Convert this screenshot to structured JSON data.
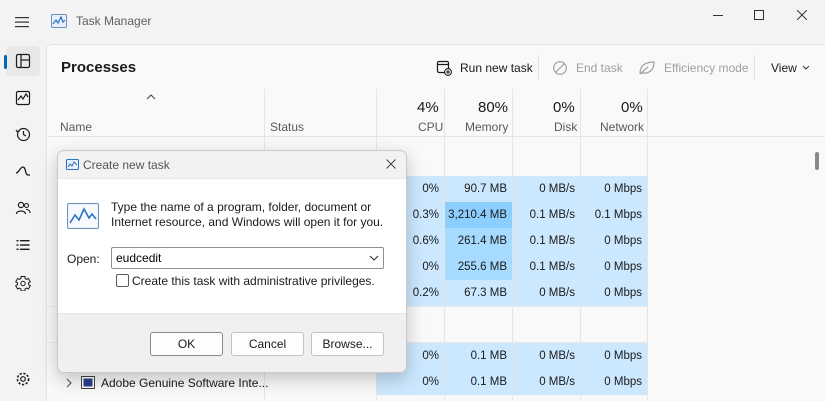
{
  "window": {
    "title": "Task Manager"
  },
  "nav": {
    "items": [
      "processes",
      "performance",
      "app-history",
      "startup-apps",
      "users",
      "details",
      "services"
    ],
    "settings": "settings"
  },
  "toolbar": {
    "title": "Processes",
    "run_new_task": "Run new task",
    "end_task": "End task",
    "efficiency_mode": "Efficiency mode",
    "view": "View"
  },
  "table": {
    "headers": {
      "name": "Name",
      "status": "Status",
      "cpu": {
        "pct": "4%",
        "label": "CPU"
      },
      "memory": {
        "pct": "80%",
        "label": "Memory"
      },
      "disk": {
        "pct": "0%",
        "label": "Disk"
      },
      "network": {
        "pct": "0%",
        "label": "Network"
      }
    },
    "rows": [
      {
        "cpu": "0%",
        "memory": "90.7 MB",
        "disk": "0 MB/s",
        "network": "0 Mbps"
      },
      {
        "cpu": "0.3%",
        "memory": "3,210.4 MB",
        "disk": "0.1 MB/s",
        "network": "0.1 Mbps"
      },
      {
        "cpu": "0.6%",
        "memory": "261.4 MB",
        "disk": "0.1 MB/s",
        "network": "0 Mbps"
      },
      {
        "cpu": "0%",
        "memory": "255.6 MB",
        "disk": "0.1 MB/s",
        "network": "0 Mbps"
      },
      {
        "cpu": "0.2%",
        "memory": "67.3 MB",
        "disk": "0 MB/s",
        "network": "0 Mbps"
      },
      {
        "cpu": "0%",
        "memory": "0.1 MB",
        "disk": "0 MB/s",
        "network": "0 Mbps"
      },
      {
        "name": "Adobe Genuine Software Inte...",
        "cpu": "0%",
        "memory": "0.1 MB",
        "disk": "0 MB/s",
        "network": "0 Mbps"
      }
    ]
  },
  "dialog": {
    "title": "Create new task",
    "description": "Type the name of a program, folder, document or Internet resource, and Windows will open it for you.",
    "open_label": "Open:",
    "open_value": "eudcedit",
    "admin_checkbox_label": "Create this task with administrative privileges.",
    "ok": "OK",
    "cancel": "Cancel",
    "browse": "Browse..."
  },
  "colors": {
    "heat_light": "#cce8ff",
    "heat_strong": "#8ccfff",
    "accent": "#0067c0"
  }
}
